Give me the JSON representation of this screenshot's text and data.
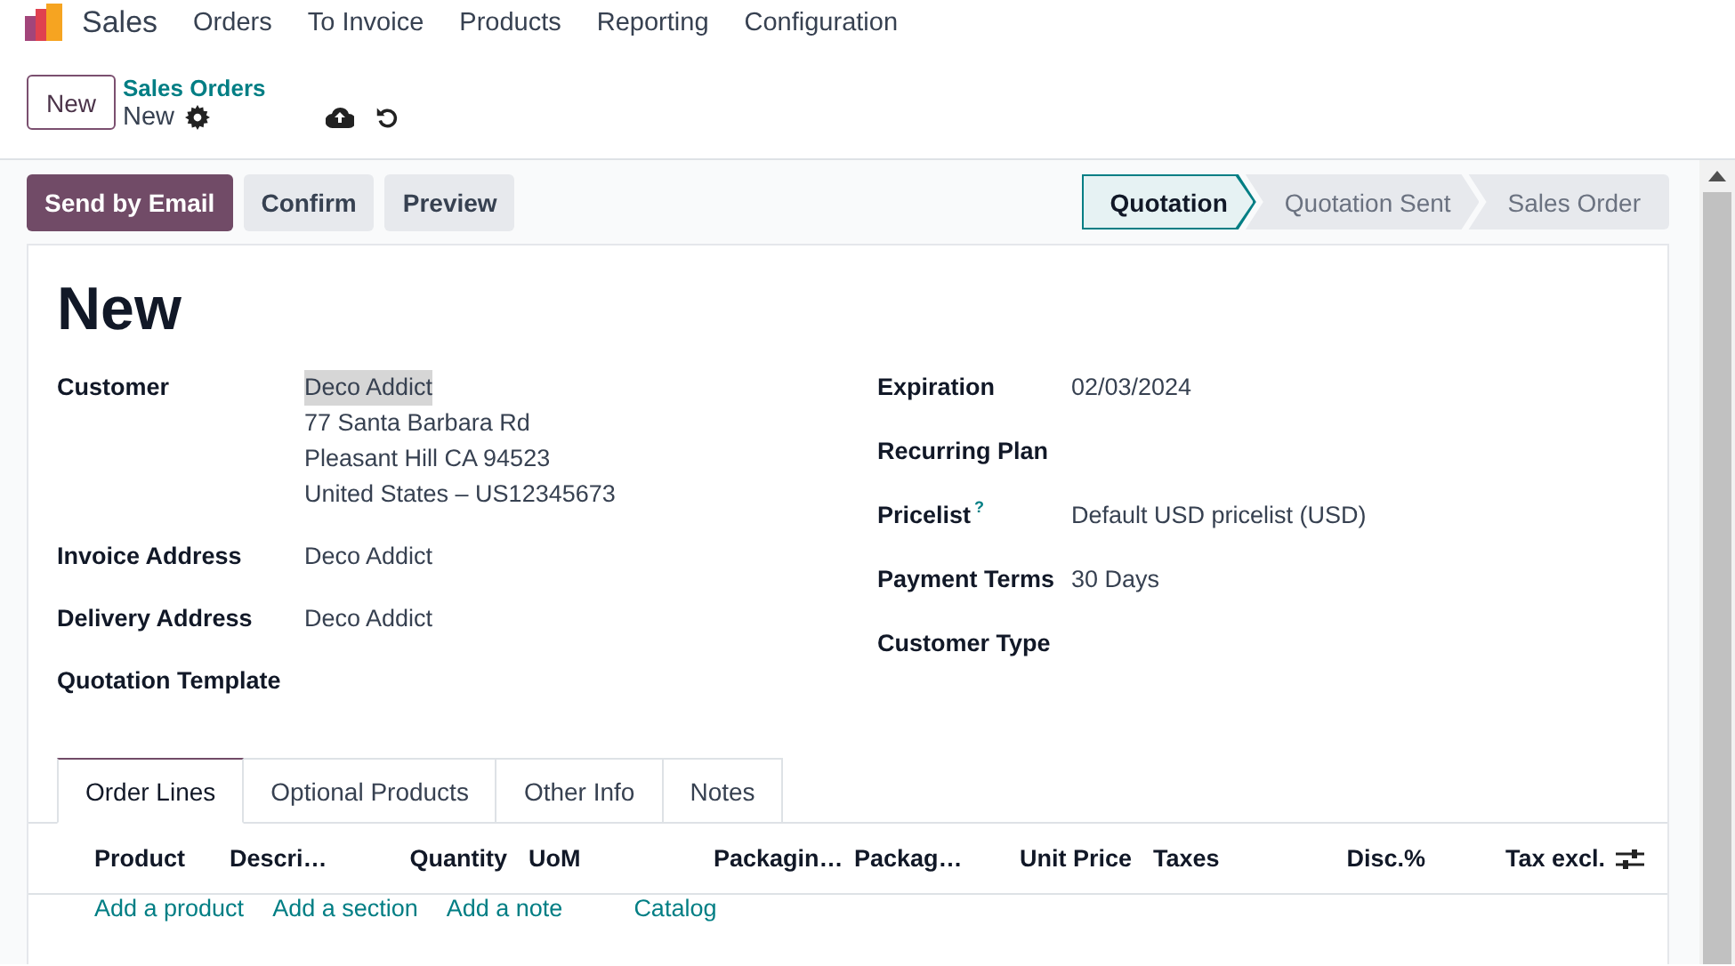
{
  "app": {
    "name": "Sales",
    "menu": [
      "Orders",
      "To Invoice",
      "Products",
      "Reporting",
      "Configuration"
    ]
  },
  "control_panel": {
    "new_button": "New",
    "breadcrumb": "Sales Orders",
    "record": "New"
  },
  "actions": [
    {
      "label": "Send by Email",
      "primary": true
    },
    {
      "label": "Confirm",
      "primary": false
    },
    {
      "label": "Preview",
      "primary": false
    }
  ],
  "stages": [
    {
      "label": "Quotation",
      "selected": true
    },
    {
      "label": "Quotation Sent",
      "selected": false
    },
    {
      "label": "Sales Order",
      "selected": false
    }
  ],
  "sheet": {
    "title": "New",
    "left_fields": [
      {
        "label": "Customer",
        "value": "Deco Addict",
        "highlighted": true,
        "address": [
          "77 Santa Barbara Rd",
          "Pleasant Hill CA 94523",
          "United States – US12345673"
        ]
      },
      {
        "label": "Invoice Address",
        "value": "Deco Addict",
        "highlighted": false
      },
      {
        "label": "Delivery Address",
        "value": "Deco Addict",
        "highlighted": false
      },
      {
        "label": "Quotation Template"
      }
    ],
    "right_fields": [
      {
        "label": "Expiration",
        "value": "02/03/2024"
      },
      {
        "label": "Recurring Plan"
      },
      {
        "label": "Pricelist",
        "help": "?",
        "value": "Default USD pricelist (USD)"
      },
      {
        "label": "Payment Terms",
        "value": "30 Days"
      },
      {
        "label": "Customer Type"
      }
    ]
  },
  "tabs": [
    {
      "label": "Order Lines",
      "selected": true
    },
    {
      "label": "Optional Products",
      "selected": false
    },
    {
      "label": "Other Info",
      "selected": false
    },
    {
      "label": "Notes",
      "selected": false
    }
  ],
  "columns": [
    {
      "label": "Product",
      "numeric": false
    },
    {
      "label": "Descri…",
      "numeric": false
    },
    {
      "label": "Quantity",
      "numeric": true
    },
    {
      "label": "UoM",
      "numeric": false
    },
    {
      "label": "Packagin…",
      "numeric": false
    },
    {
      "label": "Packag…",
      "numeric": false
    },
    {
      "label": "Unit Price",
      "numeric": true
    },
    {
      "label": "Taxes",
      "numeric": false
    },
    {
      "label": "Disc.%",
      "numeric": true
    },
    {
      "label": "Tax excl.",
      "numeric": true
    }
  ],
  "add_links": [
    "Add a product",
    "Add a section",
    "Add a note",
    "Catalog"
  ]
}
